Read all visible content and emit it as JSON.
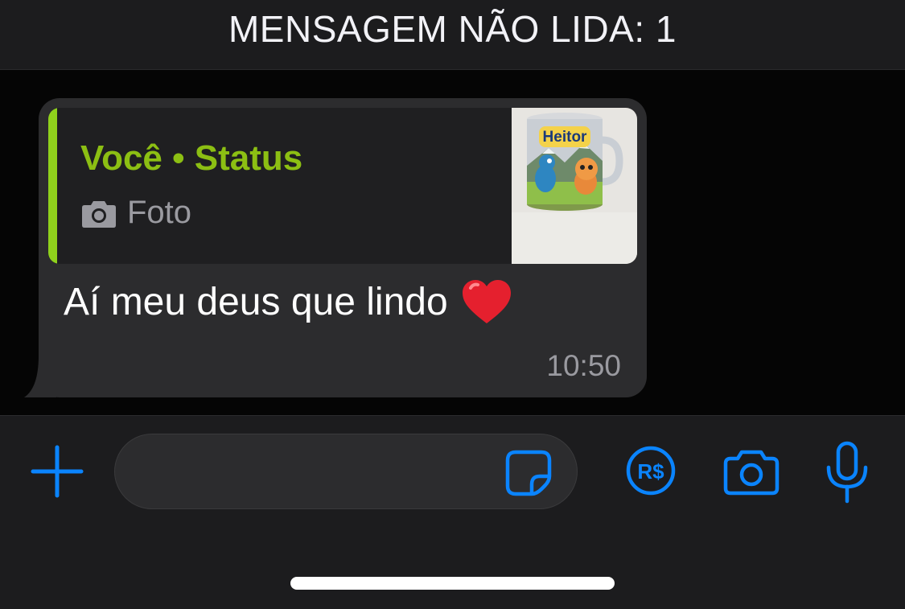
{
  "banner": {
    "unread_text": "MENSAGEM NÃO LIDA: 1"
  },
  "message": {
    "quote": {
      "author": "Você • Status",
      "type_icon": "camera-icon",
      "type_label": "Foto",
      "thumbnail_label": "Heitor"
    },
    "text": "Aí meu deus que lindo",
    "emoji": "❤️",
    "time": "10:50"
  },
  "input_bar": {
    "placeholder": "",
    "icons": [
      "plus-icon",
      "sticker-icon",
      "payment-icon",
      "camera-icon",
      "microphone-icon"
    ]
  },
  "colors": {
    "accent_blue": "#0a84ff",
    "quote_green": "#8cbf13",
    "bubble_bg": "#2c2c2e"
  }
}
